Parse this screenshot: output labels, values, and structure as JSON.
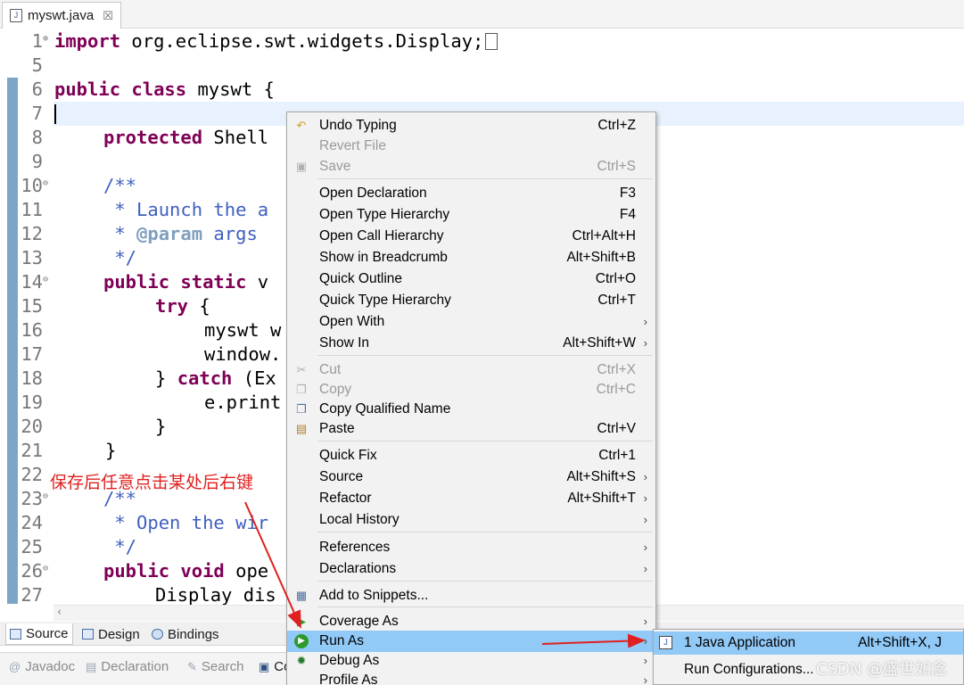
{
  "editor_tab": {
    "title": "myswt.java",
    "close": "☒"
  },
  "code_lines": [
    {
      "num": "1",
      "fold": "⊕"
    },
    {
      "num": "5"
    },
    {
      "num": "6"
    },
    {
      "num": "7"
    },
    {
      "num": "8"
    },
    {
      "num": "9"
    },
    {
      "num": "10",
      "fold": "⊖"
    },
    {
      "num": "11"
    },
    {
      "num": "12"
    },
    {
      "num": "13"
    },
    {
      "num": "14",
      "fold": "⊖"
    },
    {
      "num": "15"
    },
    {
      "num": "16"
    },
    {
      "num": "17"
    },
    {
      "num": "18"
    },
    {
      "num": "19"
    },
    {
      "num": "20"
    },
    {
      "num": "21"
    },
    {
      "num": "22"
    },
    {
      "num": "23",
      "fold": "⊖"
    },
    {
      "num": "24"
    },
    {
      "num": "25"
    },
    {
      "num": "26",
      "fold": "⊖"
    },
    {
      "num": "27"
    }
  ],
  "code": {
    "l1_kw": "import",
    "l1_rest": " org.eclipse.swt.widgets.Display;",
    "l6_kw1": "public",
    "l6_kw2": "class",
    "l6_rest": " myswt {",
    "l8_kw": "protected",
    "l8_rest": " Shell",
    "l10": "/**",
    "l11": " * Launch the a",
    "l12_a": " * ",
    "l12_tag": "@param",
    "l12_b": " args",
    "l13": " */",
    "l14_kw1": "public",
    "l14_kw2": "static",
    "l14_rest": " v",
    "l15_kw": "try",
    "l15_rest": " {",
    "l16": "myswt w",
    "l17": "window.",
    "l18_a": "} ",
    "l18_kw": "catch",
    "l18_b": " (Ex",
    "l19": "e.print",
    "l20": "}",
    "l21": "}",
    "l23": "/**",
    "l24": " * Open the wir",
    "l25": " */",
    "l26_kw1": "public",
    "l26_kw2": "void",
    "l26_rest": " ope",
    "l27": "Display dis"
  },
  "editor_bottom_tabs": [
    "Source",
    "Design",
    "Bindings"
  ],
  "view_tabs": [
    "Javadoc",
    "Declaration",
    "Search",
    "Co"
  ],
  "context_menu": {
    "items": [
      {
        "label": "Undo Typing",
        "accel": "Ctrl+Z",
        "icon": "undo-icon"
      },
      {
        "label": "Revert File",
        "accel": "",
        "disabled": true
      },
      {
        "label": "Save",
        "accel": "Ctrl+S",
        "disabled": true,
        "icon": "save-icon"
      },
      {
        "label": "Open Declaration",
        "accel": "F3"
      },
      {
        "label": "Open Type Hierarchy",
        "accel": "F4"
      },
      {
        "label": "Open Call Hierarchy",
        "accel": "Ctrl+Alt+H"
      },
      {
        "label": "Show in Breadcrumb",
        "accel": "Alt+Shift+B"
      },
      {
        "label": "Quick Outline",
        "accel": "Ctrl+O"
      },
      {
        "label": "Quick Type Hierarchy",
        "accel": "Ctrl+T"
      },
      {
        "label": "Open With",
        "accel": "",
        "submenu": true
      },
      {
        "label": "Show In",
        "accel": "Alt+Shift+W",
        "submenu": true
      },
      {
        "label": "Cut",
        "accel": "Ctrl+X",
        "disabled": true,
        "icon": "cut-icon"
      },
      {
        "label": "Copy",
        "accel": "Ctrl+C",
        "disabled": true,
        "icon": "copy-icon"
      },
      {
        "label": "Copy Qualified Name",
        "accel": "",
        "icon": "copy-qualified-icon"
      },
      {
        "label": "Paste",
        "accel": "Ctrl+V",
        "icon": "paste-icon"
      },
      {
        "label": "Quick Fix",
        "accel": "Ctrl+1"
      },
      {
        "label": "Source",
        "accel": "Alt+Shift+S",
        "submenu": true
      },
      {
        "label": "Refactor",
        "accel": "Alt+Shift+T",
        "submenu": true
      },
      {
        "label": "Local History",
        "accel": "",
        "submenu": true
      },
      {
        "label": "References",
        "accel": "",
        "submenu": true
      },
      {
        "label": "Declarations",
        "accel": "",
        "submenu": true
      },
      {
        "label": "Add to Snippets...",
        "accel": "",
        "icon": "snippet-icon"
      },
      {
        "label": "Coverage As",
        "accel": "",
        "submenu": true,
        "icon": "coverage-icon"
      },
      {
        "label": "Run As",
        "accel": "",
        "submenu": true,
        "highlighted": true,
        "icon": "run-icon"
      },
      {
        "label": "Debug As",
        "accel": "",
        "submenu": true,
        "icon": "debug-icon"
      },
      {
        "label": "Profile As",
        "accel": "",
        "submenu": true
      }
    ],
    "submenu_glyph": "›"
  },
  "run_as_submenu": [
    {
      "label": "1 Java Application",
      "accel": "Alt+Shift+X, J",
      "icon": "java-app-icon",
      "highlighted": true
    },
    {
      "label": "Run Configurations...",
      "accel": ""
    }
  ],
  "annotation": "保存后任意点击某处后右键",
  "watermark": "CSDN @盛世如念",
  "colors": {
    "keyword": "#7f0055",
    "comment": "#3f5fbf",
    "highlight": "#91c9f7",
    "annotation": "#e02020"
  }
}
